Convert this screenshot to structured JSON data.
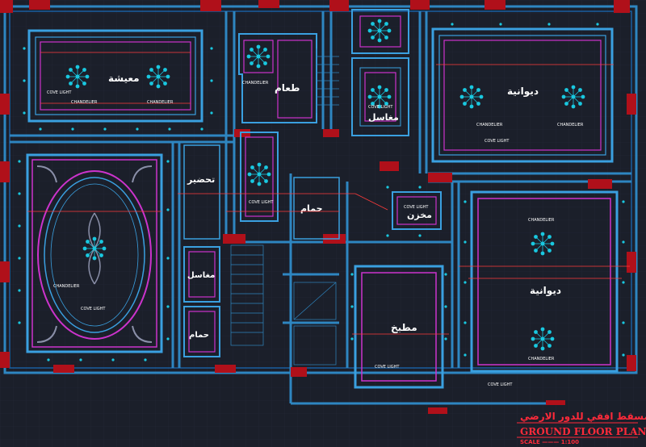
{
  "colors": {
    "background": "#1b1f2a",
    "grid": "#232838",
    "wall": "#2e86c1",
    "wall_inner": "#1a5fa0",
    "ceiling_outer": "#3aa0e0",
    "ceiling_inner": "#cc33cc",
    "light": "#19c8e0",
    "column": "#b0101a",
    "cove": "#ff3b3b",
    "title": "#ff2a3a"
  },
  "rooms": {
    "living": "معيشة",
    "dining": "طعام",
    "washbasin": "مغاسل",
    "diwan_1": "ديوانية",
    "diwan_2": "ديوانية",
    "prep": "تحضير",
    "bath_1": "حمام",
    "store": "مخزن",
    "kitchen": "مطبخ",
    "wash_2": "مغاسل",
    "bath_2": "حمام"
  },
  "labels": {
    "chandelier": "CHANDELIER",
    "cove_light": "COVE LIGHT"
  },
  "title": {
    "arabic": "المسقط افقي للدور الارضي",
    "english": "GROUND FLOOR PLAN",
    "scale": "SCALE ——— 1:100"
  }
}
